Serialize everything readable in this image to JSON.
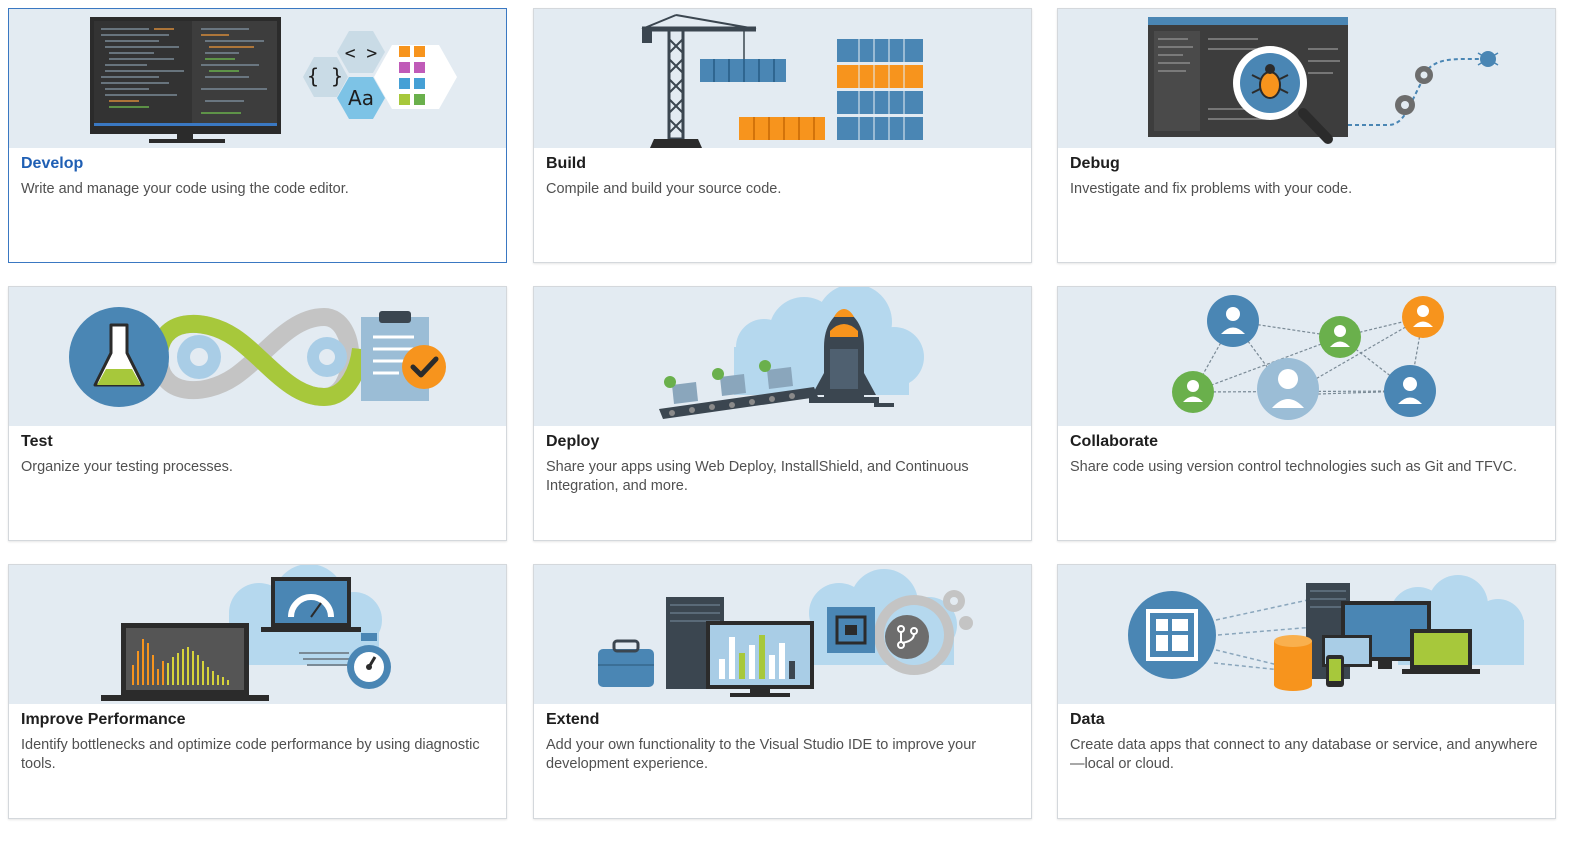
{
  "cards": [
    {
      "title": "Develop",
      "description": "Write and manage your code using the code editor.",
      "illustration": "code-editor-illustration",
      "selected": true
    },
    {
      "title": "Build",
      "description": "Compile and build your source code.",
      "illustration": "crane-containers-illustration",
      "selected": false
    },
    {
      "title": "Debug",
      "description": "Investigate and fix problems with your code.",
      "illustration": "bug-magnifier-illustration",
      "selected": false
    },
    {
      "title": "Test",
      "description": "Organize your testing processes.",
      "illustration": "flask-infinity-checklist-illustration",
      "selected": false
    },
    {
      "title": "Deploy",
      "description": "Share your apps using Web Deploy, InstallShield, and Continuous Integration, and more.",
      "illustration": "rocket-conveyor-illustration",
      "selected": false
    },
    {
      "title": "Collaborate",
      "description": "Share code using version control technologies such as Git and TFVC.",
      "illustration": "people-network-illustration",
      "selected": false
    },
    {
      "title": "Improve Performance",
      "description": "Identify bottlenecks and optimize code performance by using diagnostic tools.",
      "illustration": "laptop-gauge-stopwatch-illustration",
      "selected": false
    },
    {
      "title": "Extend",
      "description": "Add your own functionality to the Visual Studio IDE to improve your development experience.",
      "illustration": "server-extension-illustration",
      "selected": false
    },
    {
      "title": "Data",
      "description": "Create data apps that connect to any database or service, and anywhere—local or cloud.",
      "illustration": "data-devices-illustration",
      "selected": false
    }
  ],
  "illustration_text": {
    "braces": "{ }",
    "angle_brackets": "< >",
    "font_sample": "Aa"
  },
  "colors": {
    "banner_bg": "#e3ebf2",
    "selected_border": "#3a78c2",
    "selected_title": "#1f5fb4",
    "steel_blue": "#4a86b4",
    "orange": "#f7941d",
    "lime": "#a7c83b",
    "dark_slate": "#3b4650"
  }
}
